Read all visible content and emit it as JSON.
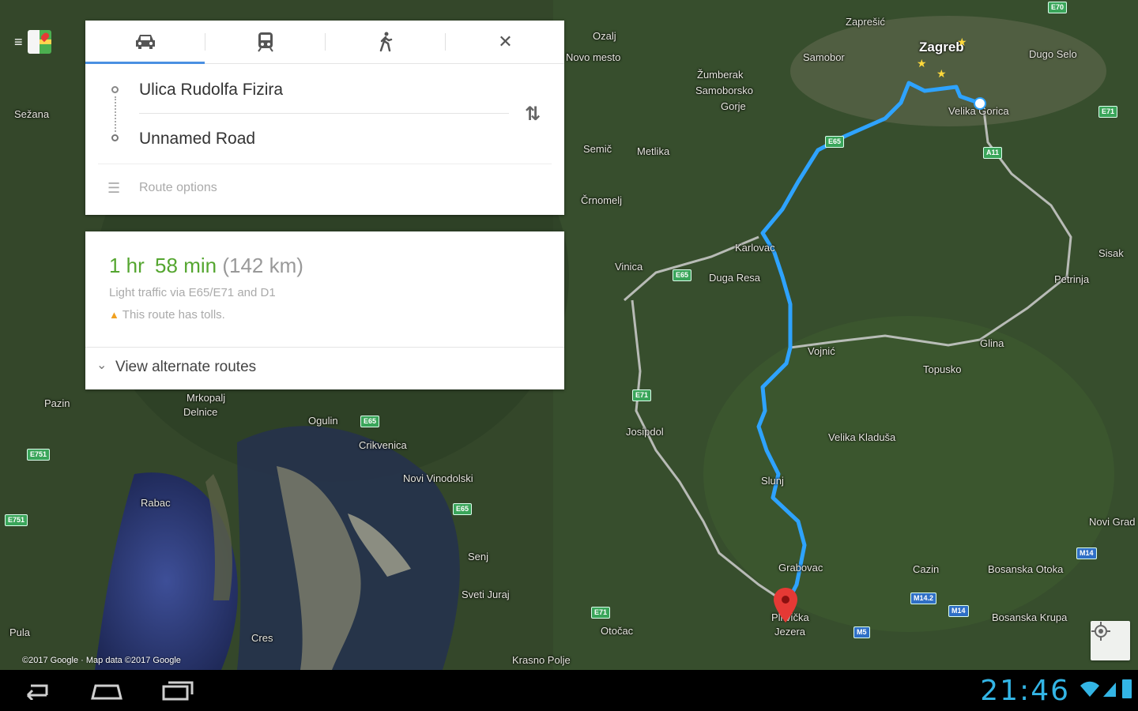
{
  "directions": {
    "modes": [
      {
        "name": "drive",
        "icon": "car-icon"
      },
      {
        "name": "transit",
        "icon": "train-icon"
      },
      {
        "name": "walk",
        "icon": "walk-icon"
      }
    ],
    "close_icon": "close-icon",
    "origin": "Ulica Rudolfa Fizira",
    "destination": "Unnamed Road",
    "route_options": "Route options",
    "accent": "#4a90e2"
  },
  "summary": {
    "time_hr": "1 hr",
    "time_min": "58 min",
    "distance": "(142 km)",
    "traffic": "Light traffic via E65/E71 and D1",
    "warning": "This route has tolls.",
    "alternate": "View alternate routes",
    "time_color": "#55a630"
  },
  "map": {
    "labels": {
      "zagreb": "Zagreb",
      "samobor": "Samobor",
      "zumberak": "Žumberak",
      "samoborsko": "Samoborsko",
      "gorje": "Gorje",
      "velika_gorica": "Velika Gorica",
      "karlovac": "Karlovac",
      "duga_resa": "Duga Resa",
      "vinica": "Vinica",
      "metlika": "Metlika",
      "semic": "Semič",
      "crnomelj": "Črnomelj",
      "petrinja": "Petrinja",
      "sisak": "Sisak",
      "vojnic": "Vojnić",
      "topusko": "Topusko",
      "glina": "Glina",
      "velika_kladusa": "Velika Kladuša",
      "slunj": "Slunj",
      "josipdol": "Josipdol",
      "grabovac": "Grabovac",
      "cazin": "Cazin",
      "bosanska_otoka": "Bosanska Otoka",
      "bosanska_krupa": "Bosanska Krupa",
      "novi_grad": "Novi Grad",
      "plitvicka": "Plitvička",
      "jezera": "Jezera",
      "ogulin": "Ogulin",
      "crikvenica": "Crikvenica",
      "novi_vinodolski": "Novi Vinodolski",
      "senj": "Senj",
      "sveti_juraj": "Sveti Juraj",
      "otocac": "Otočac",
      "krasno_polje": "Krasno Polje",
      "rabac": "Rabac",
      "pula": "Pula",
      "cres": "Cres",
      "mrkopalj": "Mrkopalj",
      "delnice": "Delnice",
      "sezana": "Sežana",
      "dugo_selo": "Dugo Selo",
      "ozalj": "Ozalj",
      "zapresic": "Zaprešić",
      "novo_mesto": "Novo mesto",
      "pazin": "Pazin"
    },
    "shields": [
      "E65",
      "E65",
      "E71",
      "E65",
      "E65",
      "E751",
      "E751",
      "E71",
      "E71",
      "M14",
      "M14.2",
      "M14",
      "M5",
      "A11",
      "E70"
    ],
    "route_color": "#2ea3ff",
    "pin_color": "#e53935",
    "copyright": "©2017 Google · Map data ©2017 Google"
  },
  "my_location_icon": "my-location-icon",
  "navbar": {
    "back_icon": "back-icon",
    "home_icon": "home-icon",
    "recents_icon": "recents-icon",
    "clock": "21:46",
    "wifi_icon": "wifi-icon",
    "signal_icon": "signal-icon",
    "battery_icon": "battery-icon"
  },
  "app_menu_icon": "maps-menu-icon"
}
